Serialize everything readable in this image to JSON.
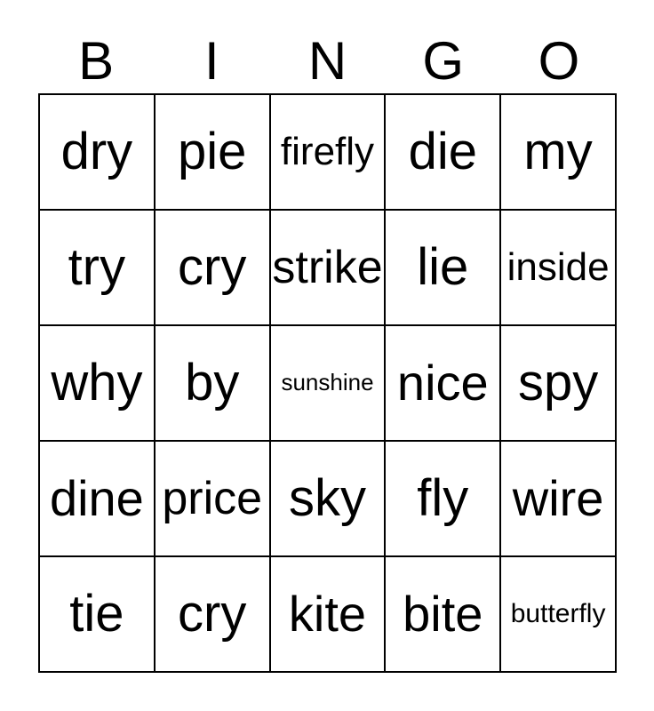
{
  "card": {
    "background_color": "#ffffff",
    "text_color": "#000000",
    "border_color": "#000000",
    "header": {
      "letters": [
        "B",
        "I",
        "N",
        "G",
        "O"
      ]
    },
    "grid": {
      "columns": 5,
      "rows": 5,
      "cells": [
        [
          {
            "text": "dry",
            "size": "fs-xl"
          },
          {
            "text": "pie",
            "size": "fs-xl"
          },
          {
            "text": "firefly",
            "size": "fs-sm"
          },
          {
            "text": "die",
            "size": "fs-xl"
          },
          {
            "text": "my",
            "size": "fs-xl"
          }
        ],
        [
          {
            "text": "try",
            "size": "fs-xl"
          },
          {
            "text": "cry",
            "size": "fs-xl"
          },
          {
            "text": "strike",
            "size": "fs-md"
          },
          {
            "text": "lie",
            "size": "fs-xl"
          },
          {
            "text": "inside",
            "size": "fs-sm"
          }
        ],
        [
          {
            "text": "why",
            "size": "fs-xl"
          },
          {
            "text": "by",
            "size": "fs-xl"
          },
          {
            "text": "sunshine",
            "size": "fs-xxs"
          },
          {
            "text": "nice",
            "size": "fs-lg"
          },
          {
            "text": "spy",
            "size": "fs-xl"
          }
        ],
        [
          {
            "text": "dine",
            "size": "fs-lg"
          },
          {
            "text": "price",
            "size": "fs-md"
          },
          {
            "text": "sky",
            "size": "fs-xl"
          },
          {
            "text": "fly",
            "size": "fs-xl"
          },
          {
            "text": "wire",
            "size": "fs-lg"
          }
        ],
        [
          {
            "text": "tie",
            "size": "fs-xl"
          },
          {
            "text": "cry",
            "size": "fs-xl"
          },
          {
            "text": "kite",
            "size": "fs-lg"
          },
          {
            "text": "bite",
            "size": "fs-lg"
          },
          {
            "text": "butterfly",
            "size": "fs-xs"
          }
        ]
      ]
    }
  }
}
